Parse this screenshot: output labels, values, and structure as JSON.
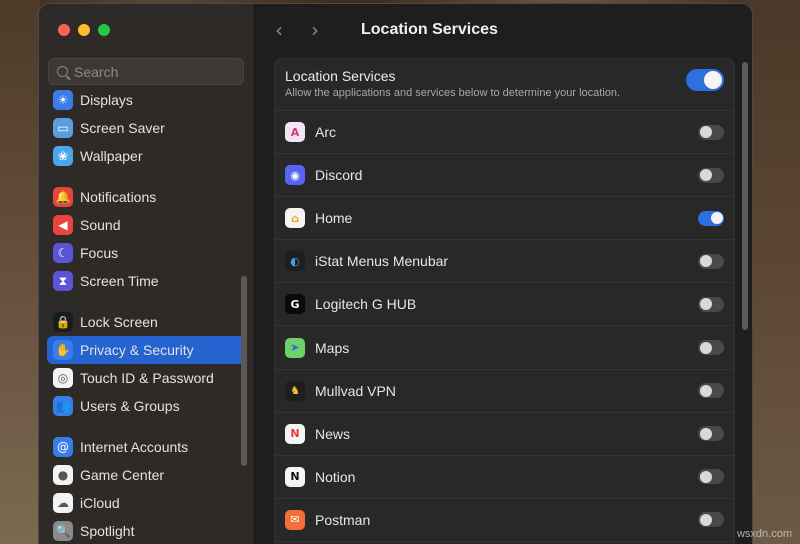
{
  "window": {
    "traffic_lights": [
      "close",
      "minimize",
      "zoom"
    ]
  },
  "sidebar": {
    "search_placeholder": "Search",
    "groups": [
      [
        {
          "label": "Displays",
          "icon": "sun-icon",
          "color": "#3b7de8",
          "glyph": "☀"
        },
        {
          "label": "Screen Saver",
          "icon": "screen-saver-icon",
          "color": "#5aa0e0",
          "glyph": "▭"
        },
        {
          "label": "Wallpaper",
          "icon": "flower-icon",
          "color": "#4aa8e8",
          "glyph": "❀"
        }
      ],
      [
        {
          "label": "Notifications",
          "icon": "bell-icon",
          "color": "#e8453c",
          "glyph": "🔔"
        },
        {
          "label": "Sound",
          "icon": "speaker-icon",
          "color": "#e8453c",
          "glyph": "◀"
        },
        {
          "label": "Focus",
          "icon": "moon-icon",
          "color": "#5b55d6",
          "glyph": "☾"
        },
        {
          "label": "Screen Time",
          "icon": "hourglass-icon",
          "color": "#5b55d6",
          "glyph": "⧗"
        }
      ],
      [
        {
          "label": "Lock Screen",
          "icon": "lock-icon",
          "color": "#1c1c1c",
          "glyph": "🔒"
        },
        {
          "label": "Privacy & Security",
          "icon": "hand-icon",
          "color": "#3b7de8",
          "glyph": "✋",
          "selected": true
        },
        {
          "label": "Touch ID & Password",
          "icon": "fingerprint-icon",
          "color": "#f3f3f3",
          "glyph": "◎"
        },
        {
          "label": "Users & Groups",
          "icon": "users-icon",
          "color": "#3b7de8",
          "glyph": "👥"
        }
      ],
      [
        {
          "label": "Internet Accounts",
          "icon": "at-icon",
          "color": "#3b7de8",
          "glyph": "@"
        },
        {
          "label": "Game Center",
          "icon": "game-center-icon",
          "color": "#f3f3f3",
          "glyph": "●"
        },
        {
          "label": "iCloud",
          "icon": "cloud-icon",
          "color": "#f3f3f3",
          "glyph": "☁"
        },
        {
          "label": "Spotlight",
          "icon": "magnifier-icon",
          "color": "#8a8a8a",
          "glyph": "🔍"
        }
      ]
    ]
  },
  "header": {
    "back": "‹",
    "forward": "›",
    "title": "Location Services"
  },
  "location": {
    "master": {
      "title": "Location Services",
      "description": "Allow the applications and services below to determine your location.",
      "enabled": true
    },
    "apps": [
      {
        "name": "Arc",
        "icon": "arc-icon",
        "color": "#f2e4f4",
        "glyph": "A",
        "glyph_color": "#d83a6e",
        "enabled": false
      },
      {
        "name": "Discord",
        "icon": "discord-icon",
        "color": "#5865f2",
        "glyph": "◉",
        "glyph_color": "#ffffff",
        "enabled": false
      },
      {
        "name": "Home",
        "icon": "home-icon",
        "color": "#f5f5f5",
        "glyph": "⌂",
        "glyph_color": "#f59b12",
        "enabled": true
      },
      {
        "name": "iStat Menus Menubar",
        "icon": "istat-icon",
        "color": "#1e1e1e",
        "glyph": "◐",
        "glyph_color": "#3aa0f0",
        "enabled": false
      },
      {
        "name": "Logitech G HUB",
        "icon": "logitech-icon",
        "color": "#0a0a0a",
        "glyph": "G",
        "glyph_color": "#ffffff",
        "enabled": false
      },
      {
        "name": "Maps",
        "icon": "maps-icon",
        "color": "#6fcf6a",
        "glyph": "➤",
        "glyph_color": "#2a6ad8",
        "enabled": false
      },
      {
        "name": "Mullvad VPN",
        "icon": "mullvad-icon",
        "color": "#1e1e1e",
        "glyph": "♞",
        "glyph_color": "#f5c23a",
        "enabled": false
      },
      {
        "name": "News",
        "icon": "news-icon",
        "color": "#f5f5f5",
        "glyph": "N",
        "glyph_color": "#e8393e",
        "enabled": false
      },
      {
        "name": "Notion",
        "icon": "notion-icon",
        "color": "#f5f5f5",
        "glyph": "N",
        "glyph_color": "#111111",
        "enabled": false
      },
      {
        "name": "Postman",
        "icon": "postman-icon",
        "color": "#f36f37",
        "glyph": "✉",
        "glyph_color": "#ffffff",
        "enabled": false
      }
    ]
  },
  "watermark": "wsxdn.com"
}
